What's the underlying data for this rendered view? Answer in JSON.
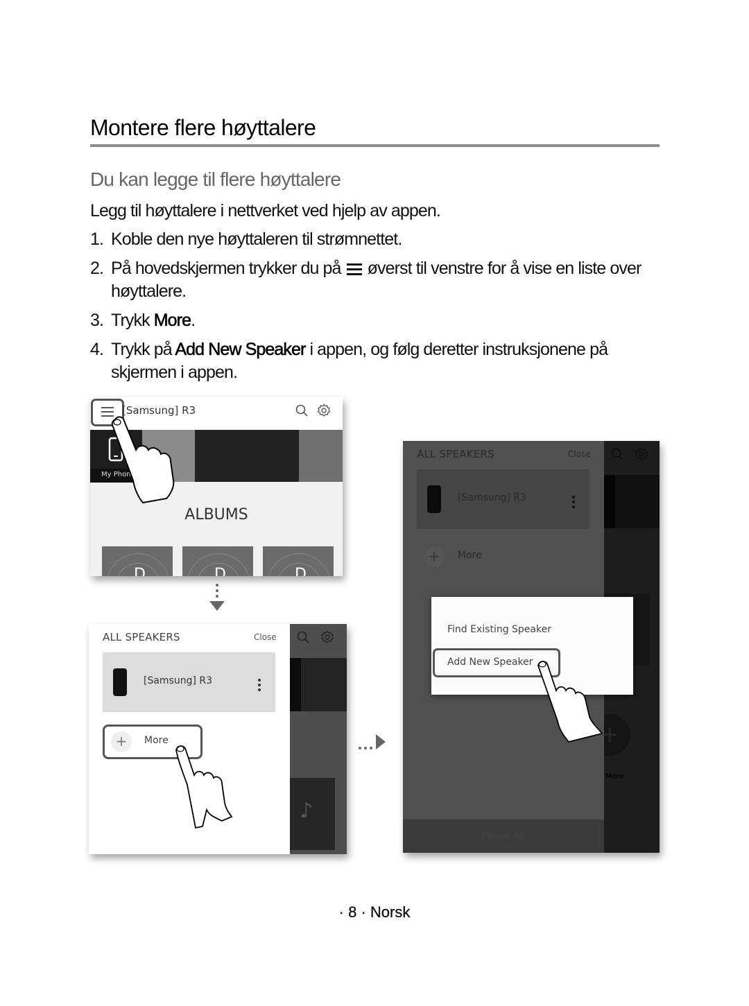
{
  "heading": {
    "title": "Montere flere høyttalere",
    "subtitle": "Du kan legge til flere høyttalere"
  },
  "intro": "Legg til høyttalere i nettverket ved hjelp av appen.",
  "steps": [
    {
      "num": "1.",
      "text": "Koble den nye høyttaleren til strømnettet."
    },
    {
      "num": "2.",
      "before": "På hovedskjermen trykker du på",
      "icon": "menu-icon",
      "after": "øverst til venstre for å vise en liste over høyttalere."
    },
    {
      "num": "3.",
      "before": "Trykk ",
      "bold": "More",
      "after": "."
    },
    {
      "num": "4.",
      "before": "Trykk på ",
      "bold": "Add New Speaker",
      "after": " i appen, og følg deretter instruksjonene på skjermen i appen."
    }
  ],
  "screen1": {
    "title": "[Samsung] R3",
    "tile_label": "My Phone",
    "section": "ALBUMS"
  },
  "screen2": {
    "panel_title": "ALL SPEAKERS",
    "close": "Close",
    "speaker": "[Samsung] R3",
    "more": "More",
    "plus": "+"
  },
  "screen3": {
    "panel_title": "ALL SPEAKERS",
    "close": "Close",
    "speaker": "[Samsung] R3",
    "more": "More",
    "plus": "+",
    "pause_all": "Pause All",
    "side_more": "More",
    "popup": {
      "find": "Find Existing Speaker",
      "add": "Add New Speaker"
    }
  },
  "footer": "· 8 · Norsk"
}
